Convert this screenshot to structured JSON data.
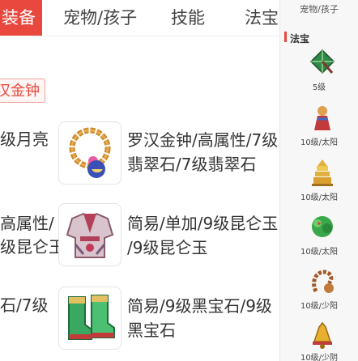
{
  "tabs": {
    "active": "装备",
    "pets": "宠物/孩子",
    "skills": "技能",
    "treasure": "法宝"
  },
  "tag": "汉金钟",
  "rows": [
    {
      "left_text": [
        "级月亮"
      ],
      "desc_line1": "罗汉金钟/高属性/7级",
      "desc_line2": "翡翠石/7级翡翠石"
    },
    {
      "left_text": [
        "高属性/",
        "级昆仑玉"
      ],
      "desc_line1": "简易/单加/9级昆仑玉",
      "desc_line2": "/9级昆仑玉"
    },
    {
      "left_text": [
        "石/7级"
      ],
      "desc_line1": "简易/9级黑宝石/9级",
      "desc_line2": "黑宝石"
    }
  ],
  "sidebar": {
    "title": "宠物/孩子",
    "section": "法宝",
    "items": [
      {
        "label": "5级"
      },
      {
        "label": "10级/太阳"
      },
      {
        "label": "10级/太阳"
      },
      {
        "label": "10级/太阳"
      },
      {
        "label": "10级/少阳"
      },
      {
        "label": "10级/少阴"
      }
    ]
  },
  "colors": {
    "accent": "#e8483d"
  },
  "icons": [
    "bead-necklace-icon",
    "armor-robe-icon",
    "boots-icon",
    "umbrella-icon",
    "figure-icon",
    "pagoda-icon",
    "green-dragon-icon",
    "rosary-icon",
    "bell-icon"
  ]
}
